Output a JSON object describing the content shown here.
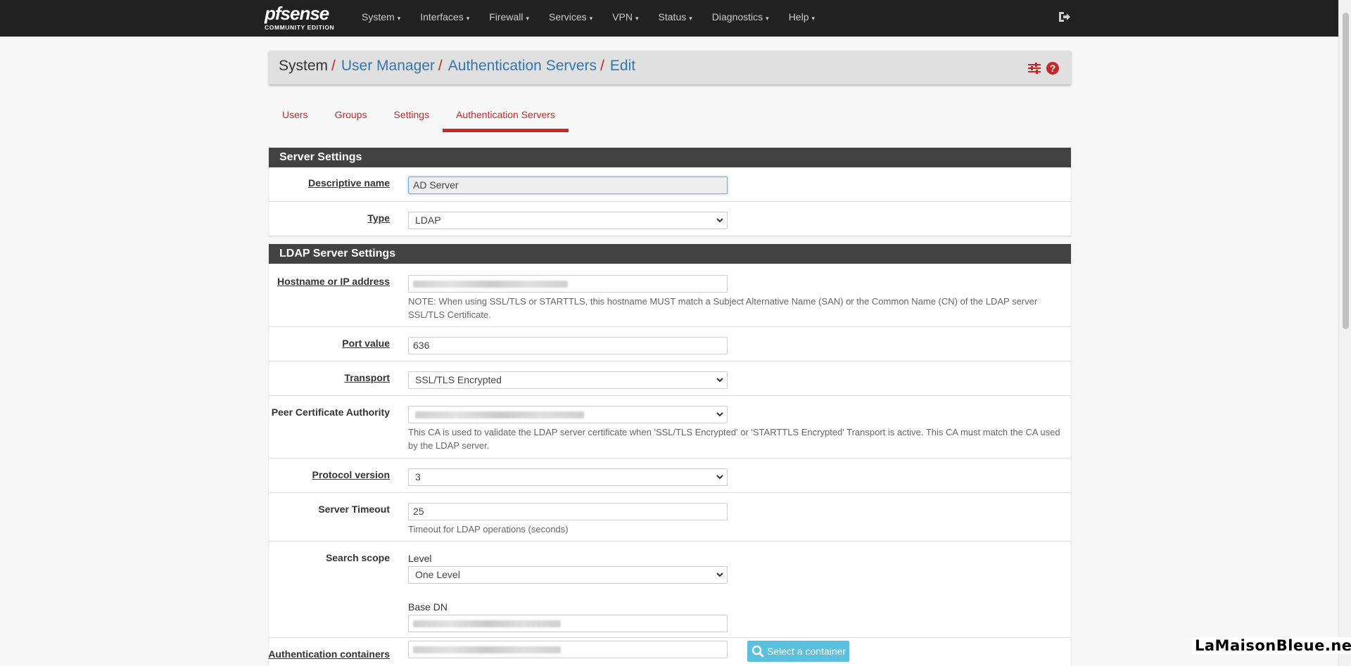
{
  "brand": {
    "logo": "pfsense",
    "sub": "COMMUNITY EDITION"
  },
  "nav": {
    "items": [
      {
        "label": "System"
      },
      {
        "label": "Interfaces"
      },
      {
        "label": "Firewall"
      },
      {
        "label": "Services"
      },
      {
        "label": "VPN"
      },
      {
        "label": "Status"
      },
      {
        "label": "Diagnostics"
      },
      {
        "label": "Help"
      }
    ],
    "caret": "▾",
    "logout_icon": "sign-out-icon"
  },
  "breadcrumb": {
    "first": "System",
    "sep": "/",
    "links": [
      "User Manager",
      "Authentication Servers",
      "Edit"
    ]
  },
  "header_icons": [
    "sliders-icon",
    "question-circle-icon"
  ],
  "tabs": [
    "Users",
    "Groups",
    "Settings",
    "Authentication Servers"
  ],
  "active_tab": "Authentication Servers",
  "server_settings": {
    "heading": "Server Settings",
    "descriptive_name": {
      "label": "Descriptive name",
      "value": "AD Server"
    },
    "type": {
      "label": "Type",
      "value": "LDAP"
    }
  },
  "ldap": {
    "heading": "LDAP Server Settings",
    "hostname": {
      "label": "Hostname or IP address",
      "help": "NOTE: When using SSL/TLS or STARTTLS, this hostname MUST match a Subject Alternative Name (SAN) or the Common Name (CN) of the LDAP server SSL/TLS Certificate."
    },
    "port": {
      "label": "Port value",
      "value": "636"
    },
    "transport": {
      "label": "Transport",
      "value": "SSL/TLS Encrypted"
    },
    "peer_ca": {
      "label": "Peer Certificate Authority",
      "help": "This CA is used to validate the LDAP server certificate when 'SSL/TLS Encrypted' or 'STARTTLS Encrypted' Transport is active. This CA must match the CA used by the LDAP server."
    },
    "protocol": {
      "label": "Protocol version",
      "value": "3"
    },
    "timeout": {
      "label": "Server Timeout",
      "value": "25",
      "help": "Timeout for LDAP operations (seconds)"
    },
    "scope": {
      "label": "Search scope",
      "level_label": "Level",
      "level_value": "One Level",
      "base_dn_label": "Base DN"
    },
    "auth_containers": {
      "label": "Authentication containers",
      "button": "Select a container"
    }
  },
  "watermark": "LaMaisonBleue.net",
  "colors": {
    "navbar": "#212121",
    "accent_red": "#c62828",
    "link_blue": "#3276b1",
    "panel_heading": "#424242",
    "info": "#5bc0de"
  }
}
